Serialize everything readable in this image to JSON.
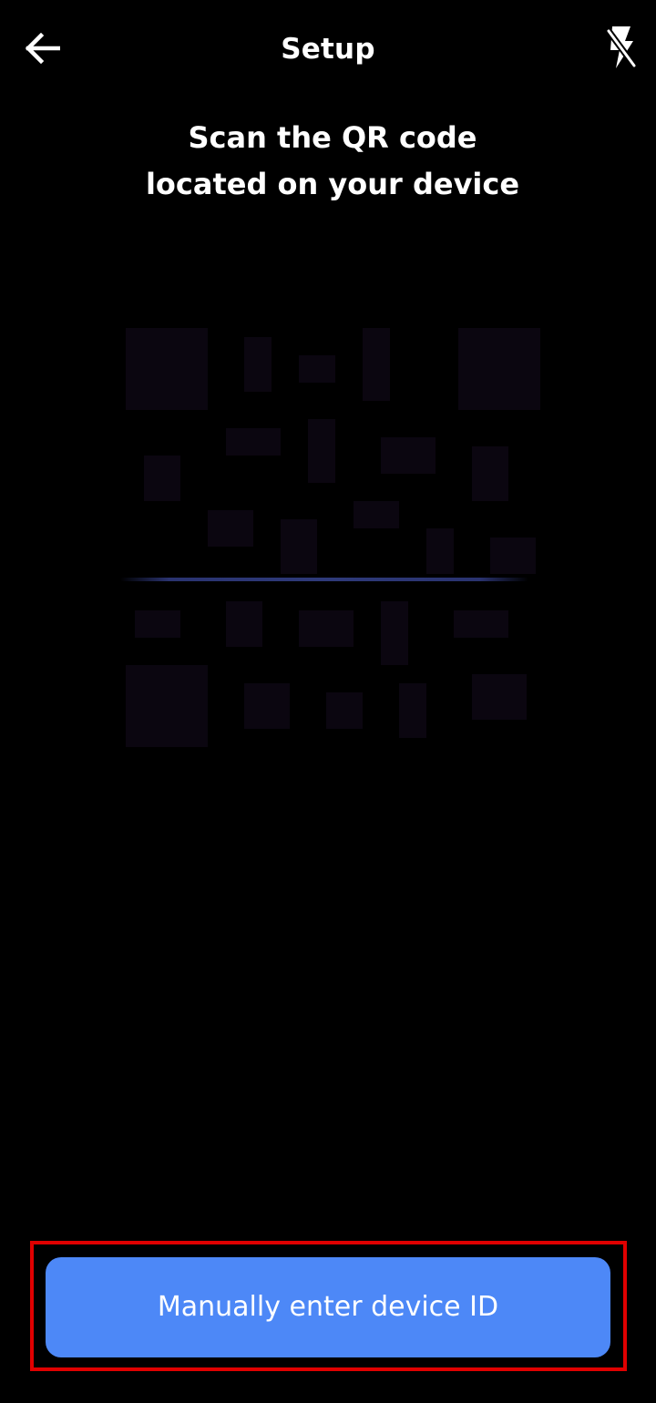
{
  "header": {
    "back_icon": "arrow-left-icon",
    "title": "Setup",
    "flash_icon": "flash-off-icon"
  },
  "instructions": {
    "line1": "Scan the QR code",
    "line2": "located on your device"
  },
  "camera": {
    "scan_line_color": "#2e3a7a"
  },
  "actions": {
    "manual_entry_label": "Manually enter device ID"
  },
  "colors": {
    "background": "#000000",
    "text": "#ffffff",
    "primary_button": "#4d88f7",
    "highlight_border": "#e00000"
  }
}
